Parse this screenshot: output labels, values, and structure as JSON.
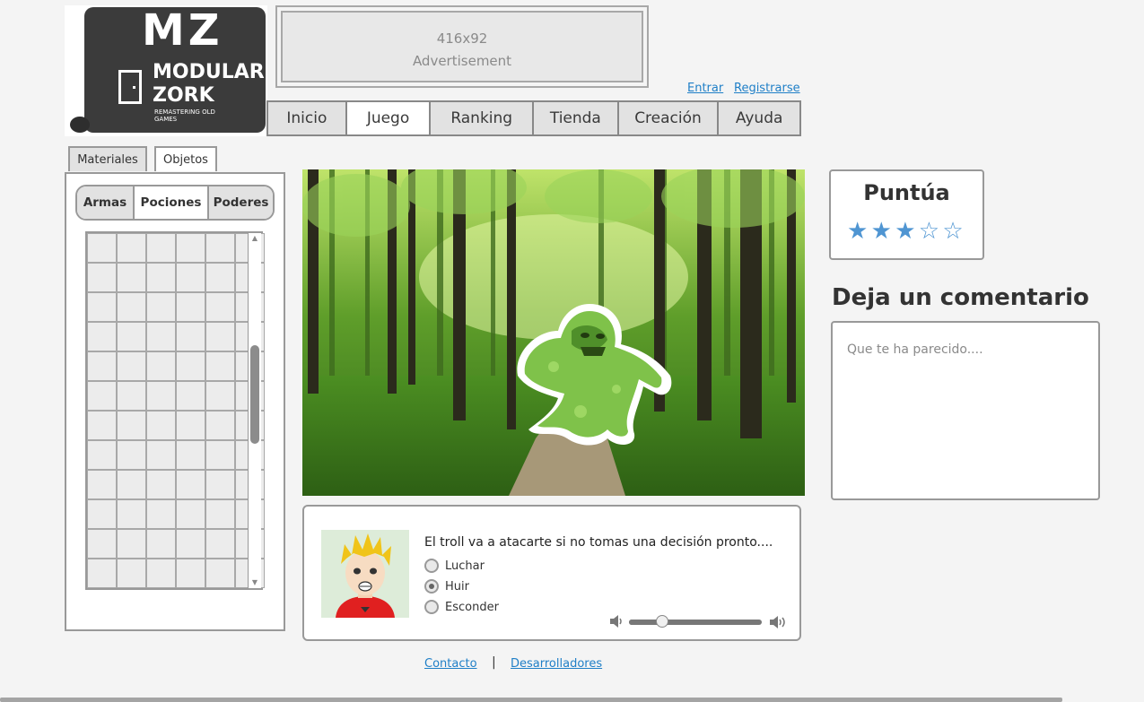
{
  "logo": {
    "mark": "MZ",
    "line1": "MODULAR",
    "line2": "ZORK",
    "tagline": "REMASTERING OLD GAMES"
  },
  "ad": {
    "size": "416x92",
    "label": "Advertisement"
  },
  "auth": {
    "login": "Entrar",
    "register": "Registrarse"
  },
  "nav": {
    "tabs": [
      "Inicio",
      "Juego",
      "Ranking",
      "Tienda",
      "Creación",
      "Ayuda"
    ],
    "active": "Juego"
  },
  "side_tabs": {
    "materials": "Materiales",
    "objects": "Objetos",
    "active": "Objetos"
  },
  "inventory": {
    "subtabs": [
      "Armas",
      "Pociones",
      "Poderes"
    ],
    "active": "Pociones",
    "grid_columns": 6,
    "grid_rows_visible": 12
  },
  "dialogue": {
    "message": "El troll va a atacarte si no tomas una decisión pronto....",
    "options": [
      "Luchar",
      "Huir",
      "Esconder"
    ],
    "selected": "Huir",
    "volume": 0.25
  },
  "rating": {
    "title": "Puntúa",
    "score": 3,
    "max": 5,
    "star_color": "#4f95d2"
  },
  "comment": {
    "title": "Deja un comentario",
    "placeholder": "Que te ha parecido...."
  },
  "footer": {
    "contact": "Contacto",
    "separator": "|",
    "developers": "Desarrolladores"
  },
  "colors": {
    "link": "#1f7fc7",
    "border": "#999999",
    "tab_inactive": "#e2e2e2"
  }
}
